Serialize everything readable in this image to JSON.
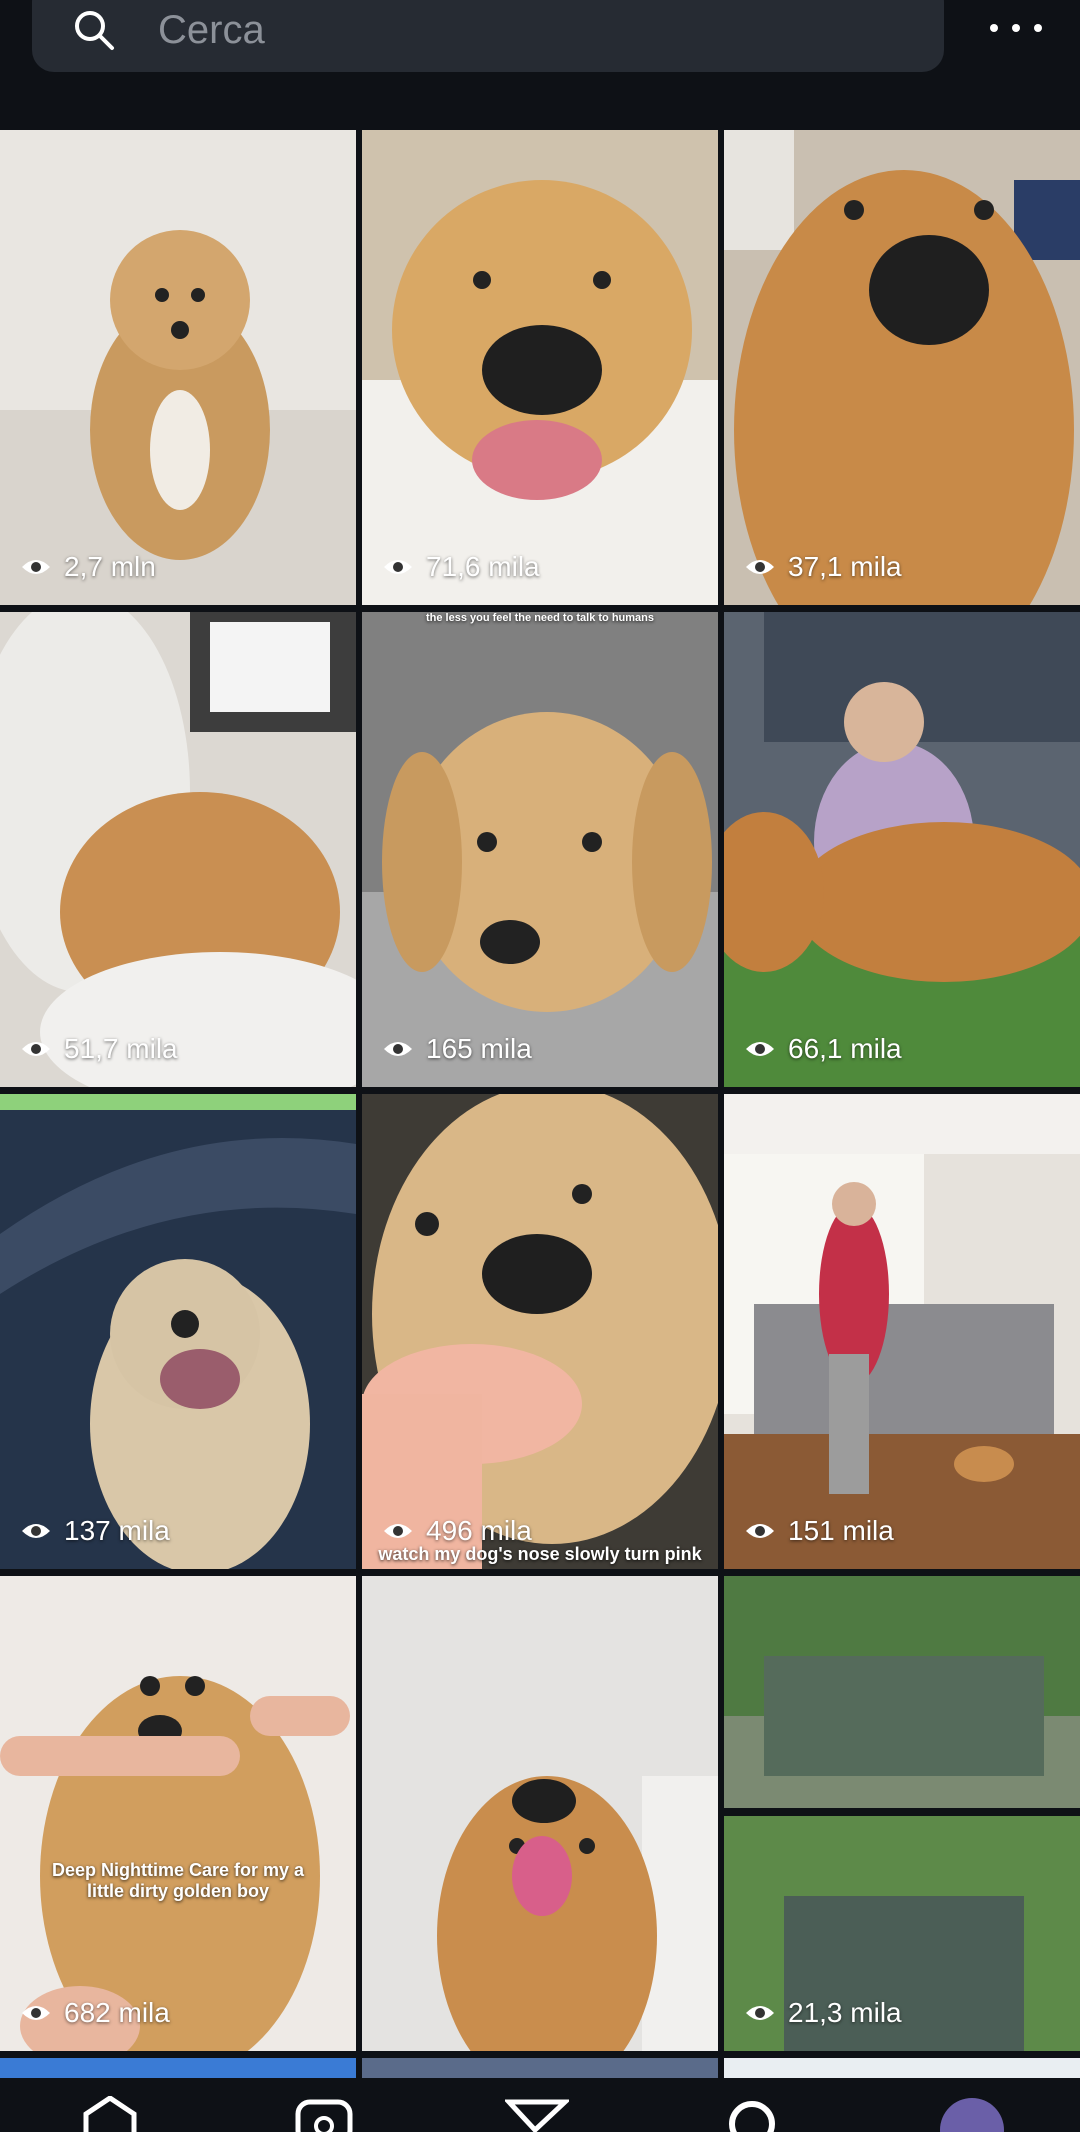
{
  "search": {
    "placeholder": "Cerca"
  },
  "tiles": [
    {
      "views": "2,7 mln",
      "color1": "#e8e4de",
      "color2": "#c99a5f"
    },
    {
      "views": "71,6 mila",
      "color1": "#d7c4a6",
      "color2": "#d8a562"
    },
    {
      "views": "37,1 mila",
      "color1": "#cdbfa9",
      "color2": "#c88a48"
    },
    {
      "views": "51,7 mila",
      "color1": "#e5e2de",
      "color2": "#c98f52"
    },
    {
      "views": "165 mila",
      "color1": "#8b8b8b",
      "color2": "#d8b07a",
      "caption": "the less you feel the need to talk to humans"
    },
    {
      "views": "66,1 mila",
      "color1": "#4f8a3b",
      "color2": "#c27f3e"
    },
    {
      "views": "137 mila",
      "color1": "#25344a",
      "color2": "#d9c7a8"
    },
    {
      "views": "496 mila",
      "color1": "#3e3b35",
      "color2": "#d9b787",
      "caption": "watch my dog's nose slowly turn pink"
    },
    {
      "views": "151 mila",
      "color1": "#e6e2dc",
      "color2": "#8b8b8f"
    },
    {
      "views": "682 mila",
      "color1": "#eeeae6",
      "color2": "#d19e5e",
      "caption": "Deep Nighttime Care for my a little dirty golden boy"
    },
    {
      "views": "",
      "color1": "#e4e3e1",
      "color2": "#c98d4d"
    },
    {
      "views": "21,3 mila",
      "color1": "#3f6b35",
      "color2": "#556b5b"
    }
  ]
}
